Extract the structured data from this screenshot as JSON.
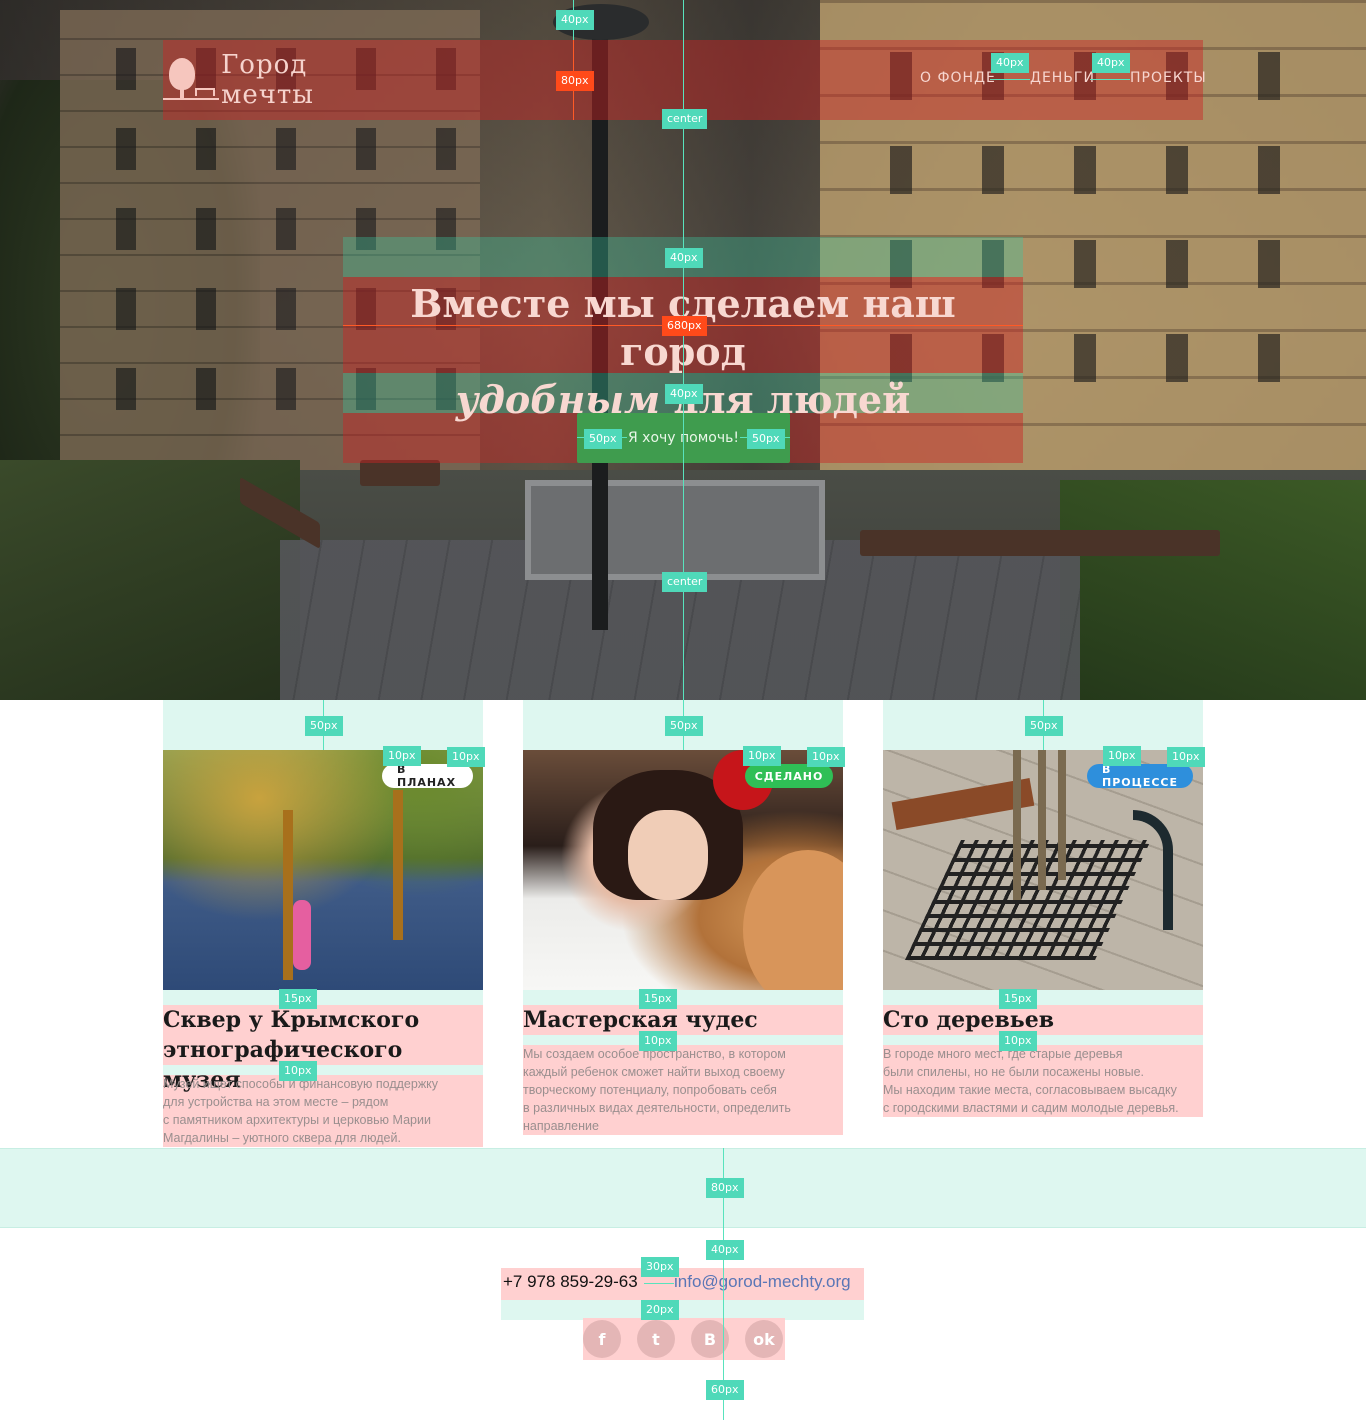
{
  "header": {
    "logo_text": "Город мечты",
    "nav": [
      {
        "label": "О фонде"
      },
      {
        "label": "Деньги"
      },
      {
        "label": "Проекты"
      }
    ]
  },
  "hero": {
    "headline_line1": "Вместе мы сделаем наш город",
    "headline_em": "удобным",
    "headline_rest": " для людей",
    "cta_label": "Я хочу помочь!"
  },
  "cards": [
    {
      "badge": "В планах",
      "title": "Сквер у Крымского этнографического музея",
      "text": "Музей ищет способы и финансовую поддержку\nдля устройства на этом месте – рядом\nс памятником архитектуры и церковью Марии\nМагдалины – уютного сквера для людей."
    },
    {
      "badge": "Сделано",
      "title": "Мастерская чудес",
      "text": "Мы создаем особое пространство, в котором\nкаждый ребенок сможет найти выход своему\nтворческому потенциалу, попробовать себя\nв различных видах деятельности, определить\nнаправление"
    },
    {
      "badge": "В процессе",
      "title": "Сто деревьев",
      "text": "В городе много мест, где старые деревья\nбыли спилены, но не были посажены новые.\nМы находим такие места, согласовываем высадку\nс городскими властями и садим молодые деревья."
    }
  ],
  "footer": {
    "phone": "+7 978 859-29-63",
    "email": "info@gorod-mechty.org",
    "social": [
      {
        "icon": "facebook-icon",
        "glyph": "f"
      },
      {
        "icon": "twitter-icon",
        "glyph": "t"
      },
      {
        "icon": "vk-icon",
        "glyph": "В"
      },
      {
        "icon": "odnoklassniki-icon",
        "glyph": "ok"
      }
    ]
  },
  "annotations": {
    "px40": "40px",
    "px80": "80px",
    "px680": "680px",
    "px50": "50px",
    "px10": "10px",
    "px15": "15px",
    "px30": "30px",
    "px20": "20px",
    "px60": "60px",
    "center": "center"
  },
  "colors": {
    "accent_green": "#3f9c4e",
    "badge_done": "#2fbf56",
    "badge_process": "#2e8fdc",
    "annotation_tag": "#4fd9b9",
    "annotation_orange": "#ff4a1a"
  }
}
